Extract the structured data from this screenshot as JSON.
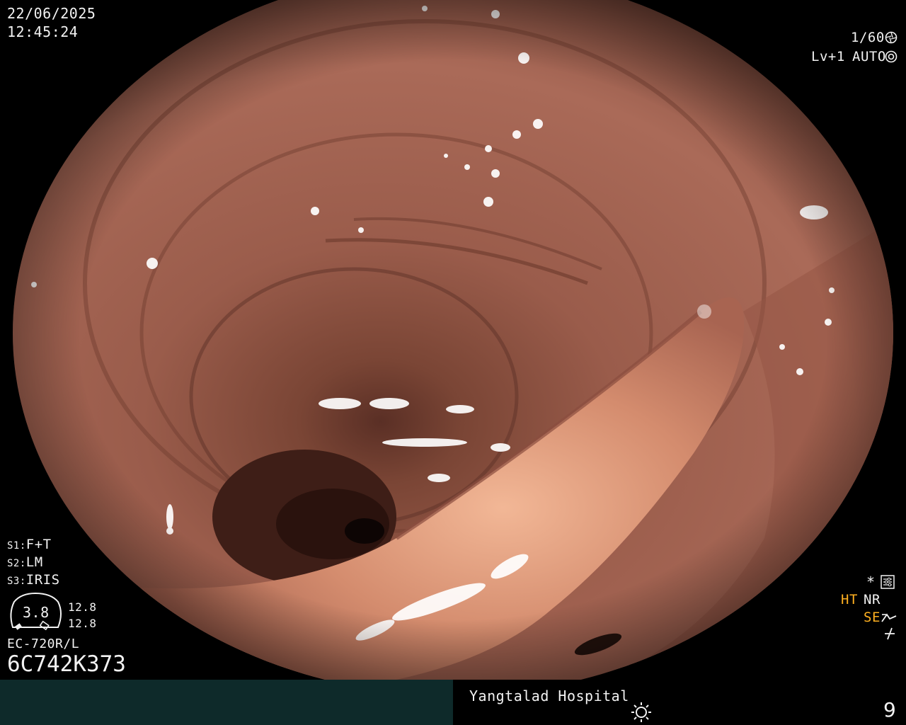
{
  "overlay": {
    "date": "22/06/2025",
    "time": "12:45:24",
    "shutter": "1/60",
    "level": "Lv+1",
    "exposure_mode": "AUTO",
    "s1_label": "S1:",
    "s1_value": "F+T",
    "s2_label": "S2:",
    "s2_value": "LM",
    "s3_label": "S3:",
    "s3_value": "IRIS",
    "gauge_value": "3.8",
    "zoom_a": "12.8",
    "zoom_b": "12.8",
    "scope_model": "EC-720R/L",
    "serial": "6C742K373",
    "star": "*",
    "ht": "HT",
    "nr": "NR",
    "se": "SE"
  },
  "footer": {
    "hospital": "Yangtalad Hospital",
    "page_number": "9"
  },
  "colors": {
    "highlight_orange": "#ffb020",
    "footer_left_bg": "#0e2a2a",
    "mucosa": "#a86a55"
  },
  "icons": [
    "shutter-icon",
    "auto-iris-icon",
    "settings-icon",
    "structure-enhance-icon",
    "freeze-icon",
    "light-sun-icon"
  ]
}
